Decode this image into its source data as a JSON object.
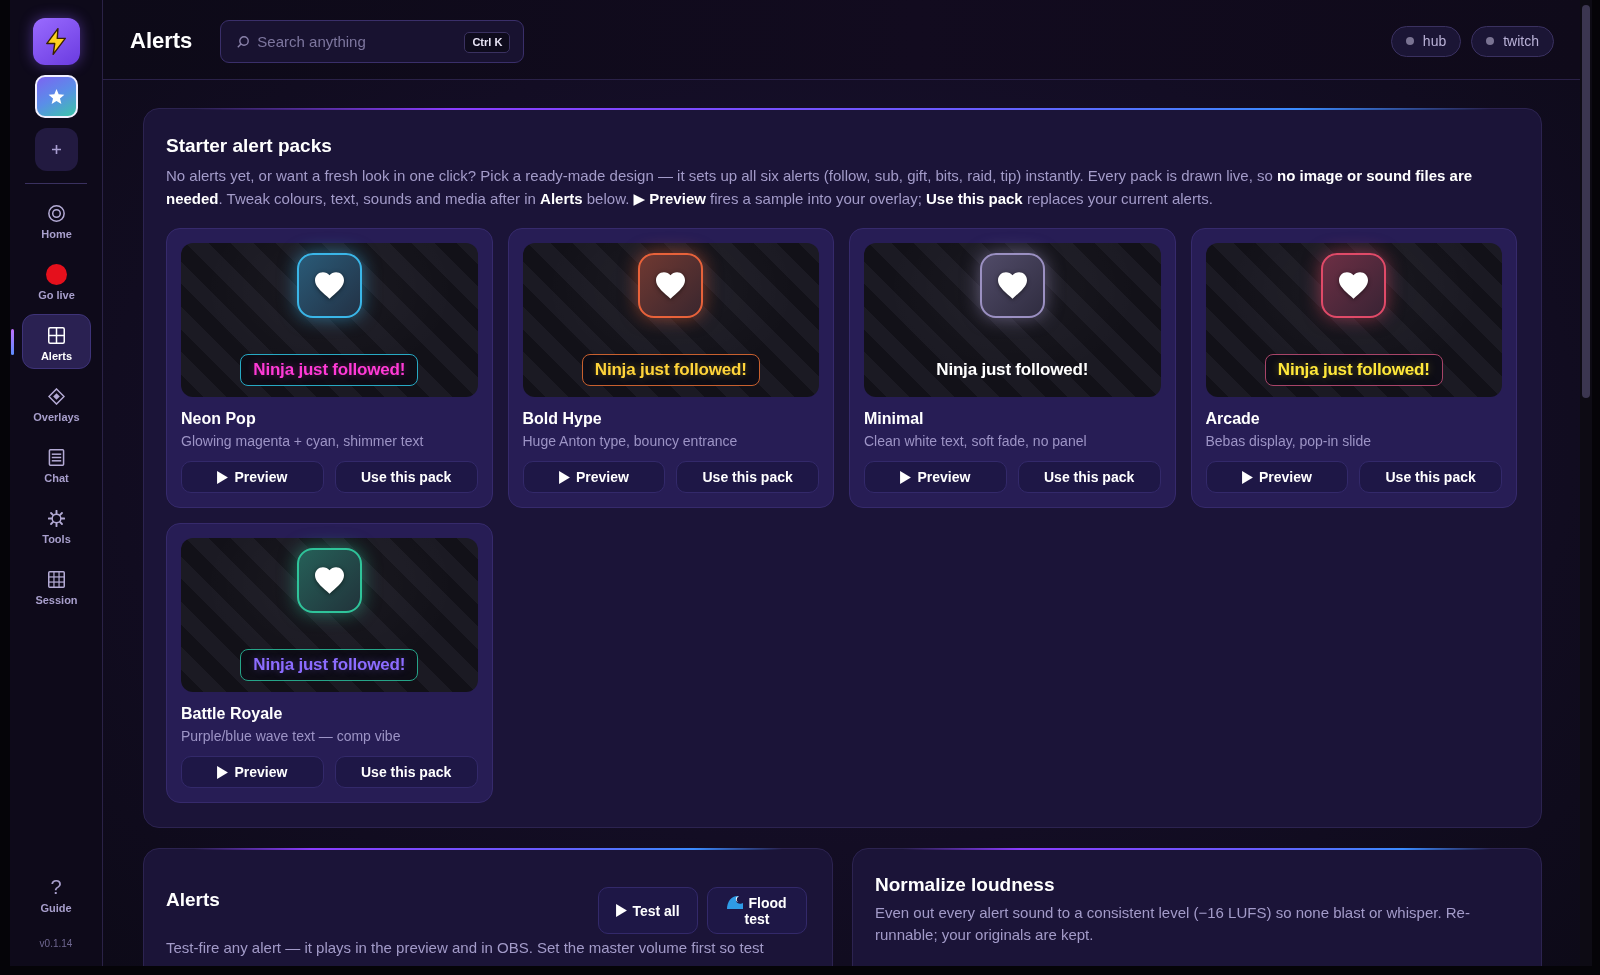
{
  "sidebar": {
    "nav": [
      {
        "label": "Home",
        "selected": false
      },
      {
        "label": "Go live",
        "selected": false
      },
      {
        "label": "Alerts",
        "selected": true
      },
      {
        "label": "Overlays",
        "selected": false
      },
      {
        "label": "Chat",
        "selected": false
      },
      {
        "label": "Tools",
        "selected": false
      },
      {
        "label": "Session",
        "selected": false
      }
    ],
    "guide": {
      "symbol": "?",
      "label": "Guide"
    },
    "version": "v0.1.14"
  },
  "topbar": {
    "title": "Alerts",
    "search": {
      "placeholder": "Search anything",
      "shortcut": "Ctrl K"
    },
    "connections": [
      {
        "label": "hub",
        "connected": false
      },
      {
        "label": "twitch",
        "connected": false
      }
    ]
  },
  "starter_packs": {
    "title": "Starter alert packs",
    "description": "No alerts yet, or want a fresh look in one click? Pick a ready-made design — it sets up all six alerts (follow, sub, gift, bits, raid, tip) instantly. Every pack is drawn live, so **no image or sound files are needed**. Tweak colours, text, sounds and media after in **Alerts** below. **▶ Preview** fires a sample into your overlay; **Use this pack** replaces your current alerts.",
    "packs": [
      {
        "name": "Neon Pop",
        "description": "Glowing magenta + cyan, shimmer text",
        "tile": {
          "color": "#3ab6e8"
        },
        "banner": {
          "text": "Ninja just followed!",
          "panel": true,
          "color": "#ff3ad6",
          "frame": {
            "color": "#27a9c4"
          }
        },
        "buttons": [
          "Preview",
          "Use this pack"
        ]
      },
      {
        "name": "Bold Hype",
        "description": "Huge Anton type, bouncy entrance",
        "tile": {
          "color": "#e8623a"
        },
        "banner": {
          "text": "Ninja just followed!",
          "panel": true,
          "color": "#ffd43a",
          "frame": {
            "color": "#c8602e"
          }
        },
        "buttons": [
          "Preview",
          "Use this pack"
        ]
      },
      {
        "name": "Minimal",
        "description": "Clean white text, soft fade, no panel",
        "tile": {
          "color": "#9b90c2"
        },
        "banner": {
          "text": "Ninja just followed!",
          "panel": false,
          "color": "#ffffff"
        },
        "buttons": [
          "Preview",
          "Use this pack"
        ]
      },
      {
        "name": "Arcade",
        "description": "Bebas display, pop-in slide",
        "tile": {
          "color": "#e04a68"
        },
        "banner": {
          "text": "Ninja just followed!",
          "panel": true,
          "color": "#ffe83a",
          "frame": {
            "color": "#a84468"
          }
        },
        "buttons": [
          "Preview",
          "Use this pack"
        ]
      },
      {
        "name": "Battle Royale",
        "description": "Purple/blue wave text — comp vibe",
        "tile": {
          "color": "#2fc49a"
        },
        "banner": {
          "text": "Ninja just followed!",
          "panel": true,
          "color": "#8c6cff",
          "frame": {
            "color": "#26a488"
          }
        },
        "buttons": [
          "Preview",
          "Use this pack"
        ]
      }
    ]
  },
  "alerts": {
    "title": "Alerts",
    "buttons": [
      "Test all",
      "Flood test"
    ],
    "description": "Test-fire any alert — it plays in the preview and in OBS. Set the master volume first so test"
  },
  "normalize": {
    "title": "Normalize loudness",
    "description": "Even out every alert sound to a consistent level (−16 LUFS) so none blast or whisper. Re-runnable; your originals are kept."
  }
}
